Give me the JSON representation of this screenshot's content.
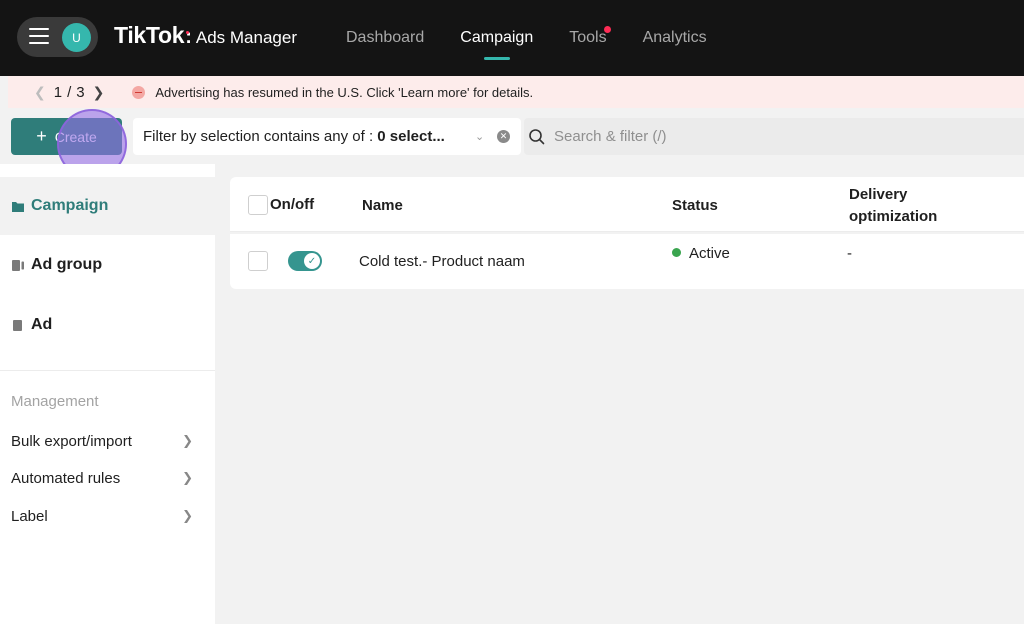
{
  "header": {
    "avatar_initial": "U",
    "brand_logo": "TikTok",
    "brand_colon": ":",
    "brand_sub": "Ads Manager",
    "nav": [
      {
        "label": "Dashboard"
      },
      {
        "label": "Campaign"
      },
      {
        "label": "Tools"
      },
      {
        "label": "Analytics"
      }
    ],
    "active_nav": "Campaign",
    "accent": "#35b7ad",
    "tools_badge_color": "#fe2c55"
  },
  "notice": {
    "pager_current": "1",
    "pager_sep": "/",
    "pager_total": "3",
    "message": "Advertising has resumed in the U.S. Click 'Learn more' for details."
  },
  "toolbar": {
    "create_label": "Create",
    "filter_prefix": "Filter by selection contains any of :",
    "filter_value": "0 select...",
    "search_placeholder": "Search & filter (/)"
  },
  "sidebar": {
    "items": [
      {
        "label": "Campaign",
        "icon": "folder-icon"
      },
      {
        "label": "Ad group",
        "icon": "ad-group-icon"
      },
      {
        "label": "Ad",
        "icon": "ad-icon"
      }
    ],
    "management_title": "Management",
    "management_items": [
      {
        "label": "Bulk export/import"
      },
      {
        "label": "Automated rules"
      },
      {
        "label": "Label"
      }
    ]
  },
  "table": {
    "columns": [
      "On/off",
      "Name",
      "Status",
      "Delivery",
      "optimization"
    ],
    "rows": [
      {
        "name": "Cold test.- Product naam",
        "status": "Active",
        "delivery": "-",
        "on": true
      }
    ],
    "status_color": "#3aa54f"
  }
}
